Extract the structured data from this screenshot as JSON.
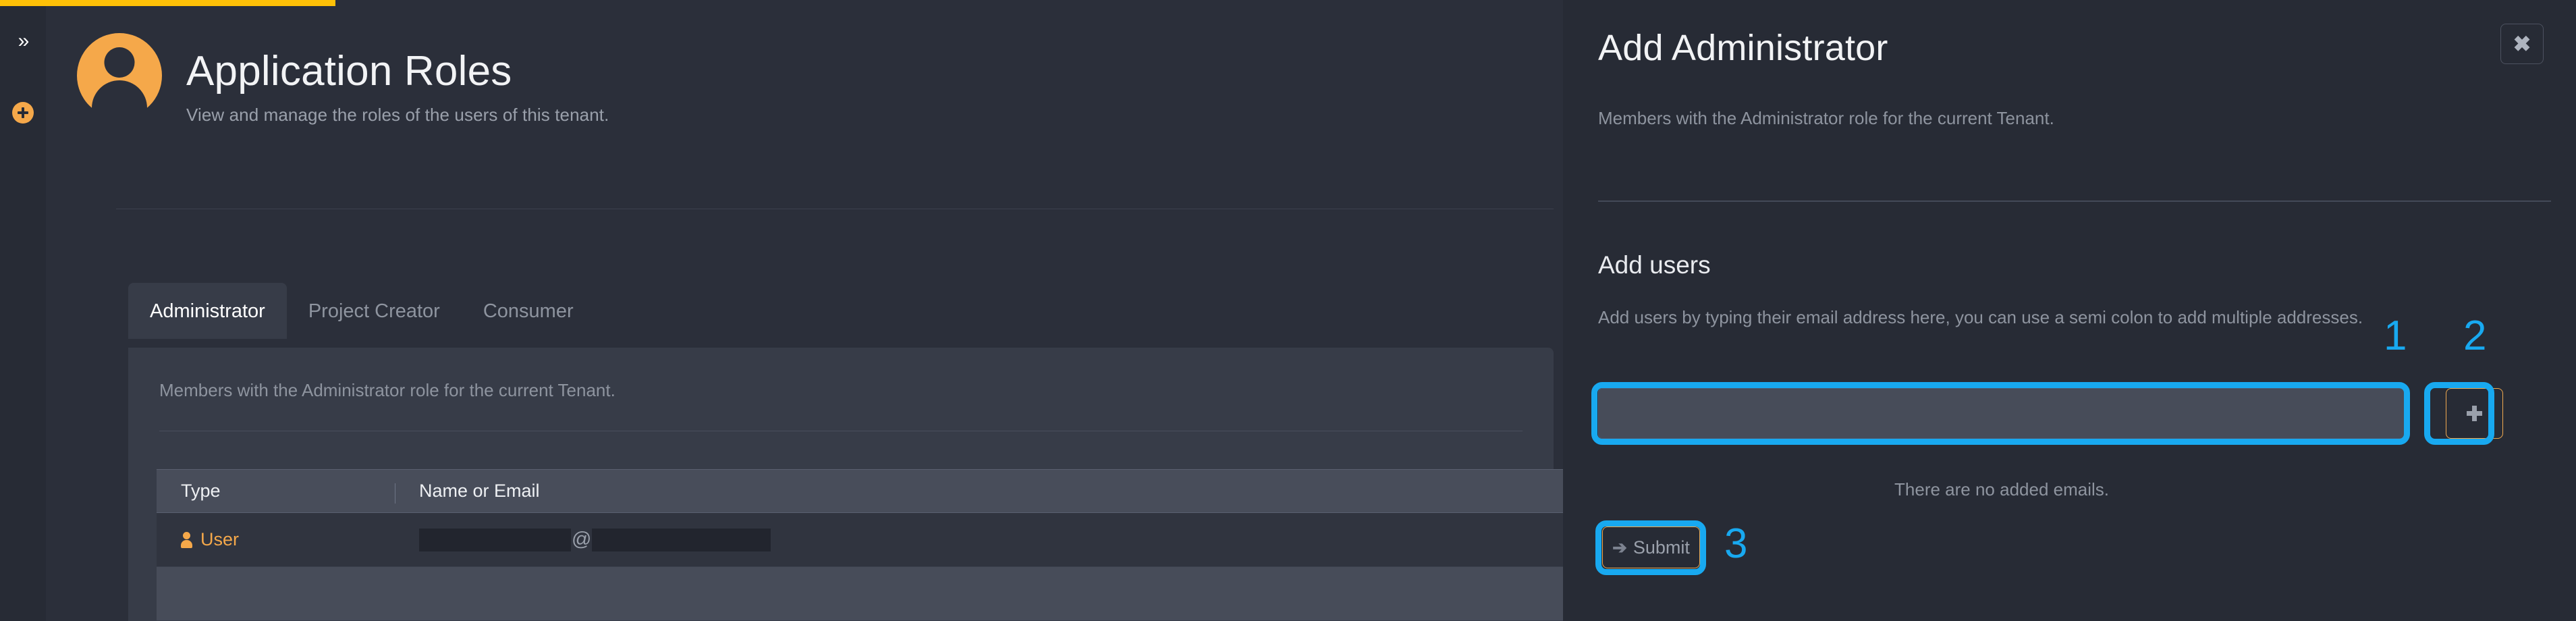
{
  "loading_bar": {
    "progress_percent": 13,
    "color": "#ffc107"
  },
  "rail": {
    "expand_icon": "double-chevron-right-icon",
    "expand_glyph": "»",
    "add_icon": "plus-circle-icon",
    "accent_color": "#f5a84a"
  },
  "page": {
    "avatar_icon": "user-avatar-icon",
    "title": "Application Roles",
    "subtitle": "View and manage the roles of the users of this tenant."
  },
  "tabs": [
    {
      "label": "Administrator",
      "active": true
    },
    {
      "label": "Project Creator",
      "active": false
    },
    {
      "label": "Consumer",
      "active": false
    }
  ],
  "tab_panel": {
    "description": "Members with the Administrator role for the current Tenant."
  },
  "table": {
    "columns": [
      "Type",
      "Name or Email"
    ],
    "rows": [
      {
        "type_icon": "user-icon",
        "type": "User",
        "name_or_email_redacted": true,
        "at_symbol": "@"
      }
    ]
  },
  "drawer": {
    "title": "Add Administrator",
    "subtitle": "Members with the Administrator role for the current Tenant.",
    "close_icon": "close-x-icon",
    "close_glyph": "✖",
    "section": {
      "title": "Add users",
      "description": "Add users by typing their email address here, you can use a semi colon to add multiple addresses."
    },
    "email_input": {
      "value": "",
      "placeholder": ""
    },
    "add_button": {
      "icon": "plus-icon",
      "label": ""
    },
    "empty_state": "There are no added emails.",
    "submit_button": {
      "icon": "arrow-right-icon",
      "glyph": "➔",
      "label": "Submit"
    }
  },
  "annotations": {
    "highlight_color": "#18a9f0",
    "markers": [
      {
        "number": "1",
        "target": "email-input"
      },
      {
        "number": "2",
        "target": "add-button"
      },
      {
        "number": "3",
        "target": "submit-button"
      }
    ]
  }
}
